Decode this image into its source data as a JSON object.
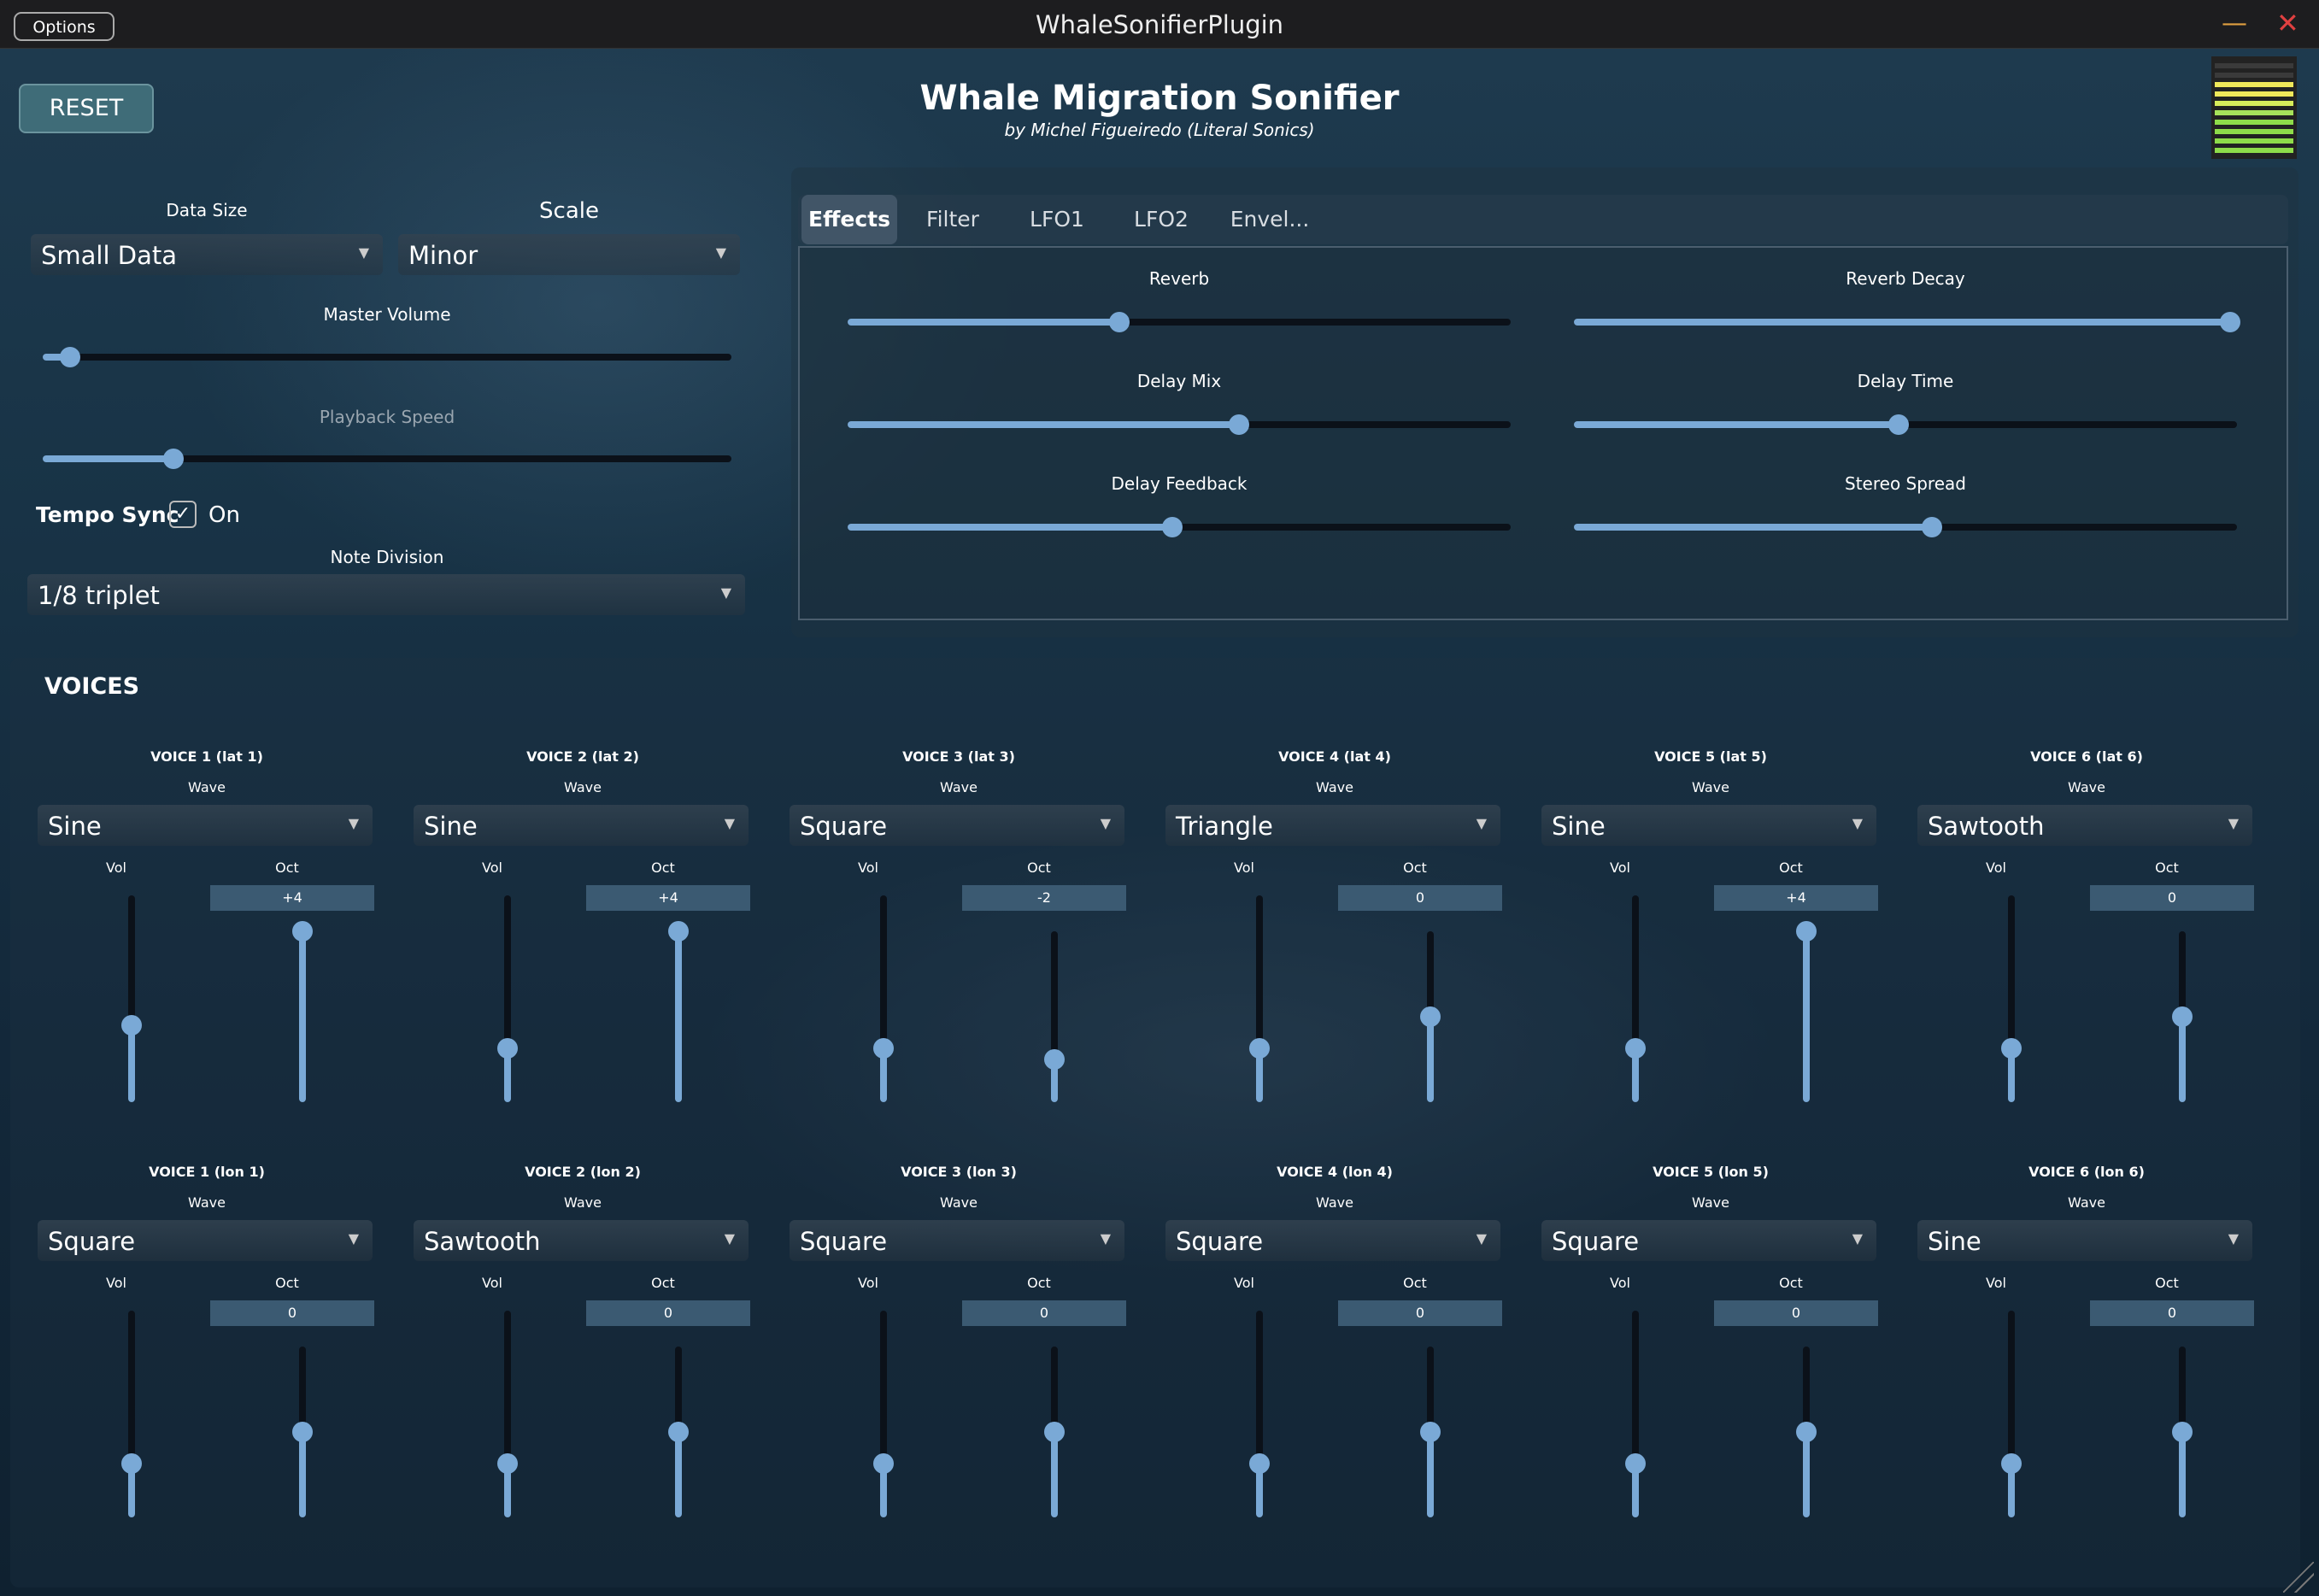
{
  "window": {
    "title": "WhaleSonifierPlugin",
    "options_label": "Options",
    "minimize_glyph": "—",
    "close_glyph": "✕"
  },
  "header": {
    "reset_label": "RESET",
    "title": "Whale Migration Sonifier",
    "subtitle": "by Michel Figueiredo (Literal Sonics)",
    "meter_levels": [
      "#3a3a3a",
      "#3a3a3a",
      "#f0e85a",
      "#f0e85a",
      "#d8ec5a",
      "#a6e25a",
      "#8edc4a",
      "#8edc4a",
      "#8edc4a",
      "#8edc4a"
    ]
  },
  "left": {
    "data_size": {
      "label": "Data Size",
      "value": "Small Data"
    },
    "scale": {
      "label": "Scale",
      "value": "Minor"
    },
    "master_volume": {
      "label": "Master Volume",
      "value": 0.04
    },
    "playback_speed": {
      "label": "Playback Speed",
      "value": 0.19
    },
    "tempo_sync": {
      "label": "Tempo Sync",
      "checked": true,
      "check_glyph": "✓",
      "state_label": "On"
    },
    "note_division": {
      "label": "Note Division",
      "value": "1/8 triplet"
    }
  },
  "tabs": [
    {
      "label": "Effects",
      "active": true
    },
    {
      "label": "Filter",
      "active": false
    },
    {
      "label": "LFO1",
      "active": false
    },
    {
      "label": "LFO2",
      "active": false
    },
    {
      "label": "Envel...",
      "active": false
    }
  ],
  "effects": [
    {
      "label": "Reverb",
      "value": 0.41
    },
    {
      "label": "Reverb Decay",
      "value": 0.99
    },
    {
      "label": "Delay Mix",
      "value": 0.59
    },
    {
      "label": "Delay Time",
      "value": 0.49
    },
    {
      "label": "Delay Feedback",
      "value": 0.49
    },
    {
      "label": "Stereo Spread",
      "value": 0.54
    }
  ],
  "voices": {
    "title": "VOICES",
    "wave_label": "Wave",
    "vol_label": "Vol",
    "oct_label": "Oct",
    "dropdown_arrow": "▼",
    "rows": [
      [
        {
          "name": "VOICE 1 (lat 1)",
          "wave": "Sine",
          "vol": 0.37,
          "oct": "+4",
          "oct_level": 1.0
        },
        {
          "name": "VOICE 2 (lat 2)",
          "wave": "Sine",
          "vol": 0.26,
          "oct": "+4",
          "oct_level": 1.0
        },
        {
          "name": "VOICE 3 (lat 3)",
          "wave": "Square",
          "vol": 0.26,
          "oct": "-2",
          "oct_level": 0.25
        },
        {
          "name": "VOICE 4 (lat 4)",
          "wave": "Triangle",
          "vol": 0.26,
          "oct": "0",
          "oct_level": 0.5
        },
        {
          "name": "VOICE 5 (lat 5)",
          "wave": "Sine",
          "vol": 0.26,
          "oct": "+4",
          "oct_level": 1.0
        },
        {
          "name": "VOICE 6 (lat 6)",
          "wave": "Sawtooth",
          "vol": 0.26,
          "oct": "0",
          "oct_level": 0.5
        }
      ],
      [
        {
          "name": "VOICE 1 (lon 1)",
          "wave": "Square",
          "vol": 0.26,
          "oct": "0",
          "oct_level": 0.5
        },
        {
          "name": "VOICE 2 (lon 2)",
          "wave": "Sawtooth",
          "vol": 0.26,
          "oct": "0",
          "oct_level": 0.5
        },
        {
          "name": "VOICE 3 (lon 3)",
          "wave": "Square",
          "vol": 0.26,
          "oct": "0",
          "oct_level": 0.5
        },
        {
          "name": "VOICE 4 (lon 4)",
          "wave": "Square",
          "vol": 0.26,
          "oct": "0",
          "oct_level": 0.5
        },
        {
          "name": "VOICE 5 (lon 5)",
          "wave": "Square",
          "vol": 0.26,
          "oct": "0",
          "oct_level": 0.5
        },
        {
          "name": "VOICE 6 (lon 6)",
          "wave": "Sine",
          "vol": 0.26,
          "oct": "0",
          "oct_level": 0.5
        }
      ]
    ]
  }
}
